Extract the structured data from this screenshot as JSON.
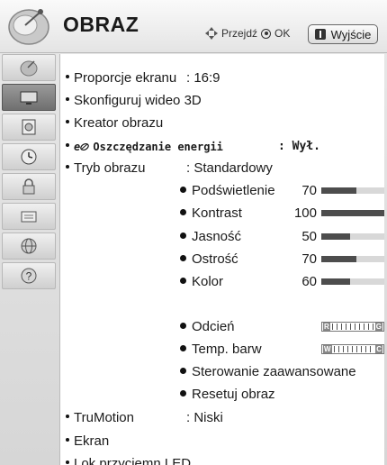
{
  "header": {
    "title": "OBRAZ",
    "nav_hint": "Przejdź",
    "ok_label": "OK",
    "exit_label": "Wyjście"
  },
  "sidebar": {
    "items": [
      {
        "icon": "satellite-dish-icon",
        "active": false
      },
      {
        "icon": "tv-screen-icon",
        "active": true
      },
      {
        "icon": "speaker-icon",
        "active": false
      },
      {
        "icon": "clock-icon",
        "active": false
      },
      {
        "icon": "lock-icon",
        "active": false
      },
      {
        "icon": "input-icon",
        "active": false
      },
      {
        "icon": "globe-icon",
        "active": false
      },
      {
        "icon": "help-icon",
        "active": false
      }
    ]
  },
  "menu": {
    "aspect_label": "Proporcje ekranu",
    "aspect_value": ": 16:9",
    "video3d_label": "Skonfiguruj wideo 3D",
    "wizard_label": "Kreator obrazu",
    "energy_prefix": "e",
    "energy_label": "Oszczędzanie energii",
    "energy_value": ": Wył.",
    "mode_label": "Tryb obrazu",
    "mode_value": ": Standardowy",
    "settings": [
      {
        "label": "Podświetlenie",
        "value": "70",
        "level": 0.56
      },
      {
        "label": "Kontrast",
        "value": "100",
        "level": 1.0
      },
      {
        "label": "Jasność",
        "value": "50",
        "level": 0.46
      },
      {
        "label": "Ostrość",
        "value": "70",
        "level": 0.56
      },
      {
        "label": "Kolor",
        "value": "60",
        "level": 0.46
      }
    ],
    "tint": {
      "label": "Odcień",
      "value": "0",
      "left": "R",
      "right": "G"
    },
    "temp": {
      "label": "Temp. barw",
      "value": "0",
      "left": "W",
      "right": "C"
    },
    "advanced_label": "Sterowanie zaawansowane",
    "reset_label": "Resetuj obraz",
    "trumotion_label": "TruMotion",
    "trumotion_value": ": Niski",
    "screen_label": "Ekran",
    "led_label": "Lok.przyciemn.LED"
  }
}
